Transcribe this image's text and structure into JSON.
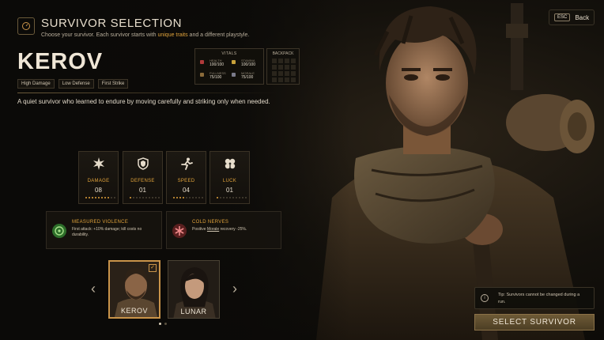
{
  "header": {
    "title": "SURVIVOR SELECTION",
    "subtitle_before": "Choose your survivor. Each survivor starts with",
    "subtitle_highlight": "unique traits",
    "subtitle_after": "and a different playstyle.",
    "icon": "gauge-icon"
  },
  "back": {
    "key": "ESC",
    "label": "Back"
  },
  "survivor": {
    "name": "KEROV",
    "tags": [
      "High Damage",
      "Low Defense",
      "First Strike"
    ],
    "description": "A quiet survivor who learned to endure by moving carefully and striking only when needed."
  },
  "vitals": {
    "title": "VITALS",
    "items": [
      {
        "label": "HEALTH",
        "value": "100/100",
        "icon": "heart-icon"
      },
      {
        "label": "STAMINA",
        "value": "100/100",
        "icon": "stamina-icon"
      },
      {
        "label": "FULLNESS",
        "value": "75/100",
        "icon": "food-icon"
      },
      {
        "label": "MORALE",
        "value": "75/100",
        "icon": "morale-icon"
      }
    ]
  },
  "backpack": {
    "title": "BACKPACK",
    "slots": 16
  },
  "stats": [
    {
      "label": "DAMAGE",
      "value": "08",
      "level": 8,
      "max": 10,
      "icon": "burst-icon"
    },
    {
      "label": "DEFENSE",
      "value": "01",
      "level": 1,
      "max": 10,
      "icon": "shield-icon"
    },
    {
      "label": "SPEED",
      "value": "04",
      "level": 4,
      "max": 10,
      "icon": "runner-icon"
    },
    {
      "label": "LUCK",
      "value": "01",
      "level": 1,
      "max": 10,
      "icon": "clover-icon"
    }
  ],
  "traits": [
    {
      "name": "MEASURED VIOLENCE",
      "desc_before": "First attack: +10% damage; kill costs no durability.",
      "desc_u": "",
      "desc_after": "",
      "icon": "target-icon",
      "color": "#3f9a3a"
    },
    {
      "name": "COLD NERVES",
      "desc_before": "Positive ",
      "desc_u": "Morale",
      "desc_after": " recovery -25%.",
      "icon": "asterisk-icon",
      "color": "#b03a3a"
    }
  ],
  "carousel": {
    "cards": [
      {
        "name": "KEROV",
        "selected": true
      },
      {
        "name": "LUNAR",
        "selected": false
      }
    ],
    "prev": "‹",
    "next": "›",
    "page": 1,
    "pages": 2
  },
  "tip": {
    "icon": "info-icon",
    "text": "Tip: Survivors cannot be changed during a run."
  },
  "select_button": "SELECT SURVIVOR",
  "colors": {
    "accent": "#e0a23b",
    "panel": "#16130e",
    "border": "#3d3528"
  }
}
